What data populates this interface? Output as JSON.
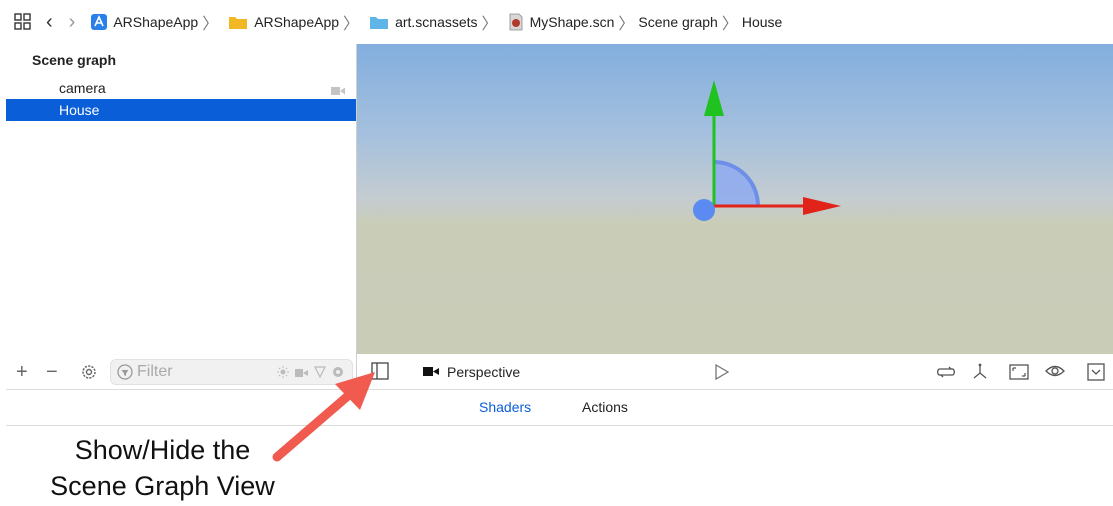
{
  "breadcrumb": {
    "items": [
      {
        "label": "ARShapeApp",
        "icon": "app-project-icon"
      },
      {
        "label": "ARShapeApp",
        "icon": "folder-icon"
      },
      {
        "label": "art.scnassets",
        "icon": "scnassets-folder-icon"
      },
      {
        "label": "MyShape.scn",
        "icon": "scene-file-icon"
      },
      {
        "label": "Scene graph",
        "icon": ""
      },
      {
        "label": "House",
        "icon": ""
      }
    ]
  },
  "scene_graph": {
    "title": "Scene graph",
    "nodes": [
      {
        "label": "camera",
        "selected": false
      },
      {
        "label": "House",
        "selected": true
      }
    ]
  },
  "sidebar_bottom": {
    "add": "+",
    "remove": "−",
    "filter_placeholder": "Filter"
  },
  "viewport_toolbar": {
    "camera_mode": "Perspective"
  },
  "tabs": [
    {
      "label": "Shaders",
      "active": true
    },
    {
      "label": "Actions",
      "active": false
    }
  ],
  "annotation": {
    "line1": "Show/Hide the",
    "line2": "Scene Graph View"
  },
  "colors": {
    "selection": "#0a5fd8",
    "x_axis": "#e2231a",
    "y_axis": "#1fc21f",
    "callout": "#f05a4f"
  }
}
